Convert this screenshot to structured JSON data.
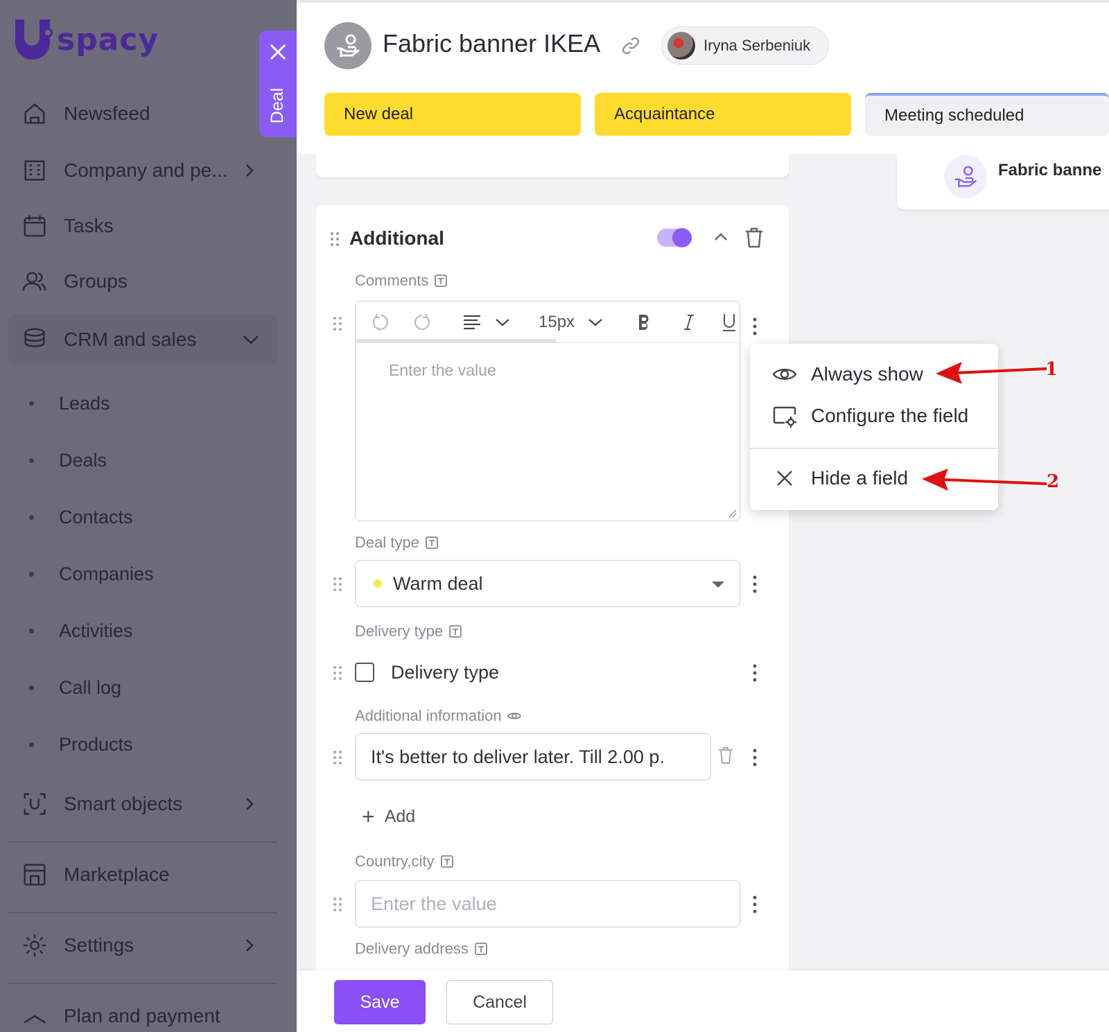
{
  "sidebar": {
    "logo_text": "spacy",
    "items": [
      {
        "label": "Newsfeed",
        "icon": "home-icon"
      },
      {
        "label": "Company and pe...",
        "icon": "company-icon"
      },
      {
        "label": "Tasks",
        "icon": "calendar-icon"
      },
      {
        "label": "Groups",
        "icon": "groups-icon"
      },
      {
        "label": "CRM and sales",
        "icon": "crm-icon"
      },
      {
        "label": "Smart objects",
        "icon": "smart-objects-icon"
      },
      {
        "label": "Marketplace",
        "icon": "marketplace-icon"
      },
      {
        "label": "Settings",
        "icon": "gear-icon"
      },
      {
        "label": "Plan and payment",
        "icon": "plan-icon"
      }
    ],
    "crm_subitems": [
      "Leads",
      "Deals",
      "Contacts",
      "Companies",
      "Activities",
      "Call log",
      "Products"
    ]
  },
  "deal_tab": {
    "label": "Deal"
  },
  "header": {
    "title": "Fabric banner IKEA",
    "user_name": "Iryna Serbeniuk",
    "stages": [
      {
        "label": "New deal",
        "state": "done"
      },
      {
        "label": "Acquaintance",
        "state": "done"
      },
      {
        "label": "Meeting scheduled",
        "state": "next"
      }
    ]
  },
  "right_card": {
    "title": "Fabric banne"
  },
  "section": {
    "title": "Additional",
    "enabled": true,
    "fields": {
      "comments": {
        "label": "Comments",
        "placeholder": "Enter the value"
      },
      "editor_font_size": "15px",
      "deal_type": {
        "label": "Deal type",
        "value": "Warm deal"
      },
      "delivery_type": {
        "label": "Delivery type",
        "checkbox_label": "Delivery type",
        "checked": false
      },
      "additional_info": {
        "label": "Additional information",
        "value": "It's better to deliver later. Till 2.00 p."
      },
      "add_label": "Add",
      "country_city": {
        "label": "Country,city",
        "placeholder": "Enter the value"
      },
      "delivery_address": {
        "label": "Delivery address"
      }
    }
  },
  "context_menu": {
    "items": [
      {
        "label": "Always show",
        "icon": "eye-icon"
      },
      {
        "label": "Configure the field",
        "icon": "configure-icon"
      },
      {
        "label": "Hide a field",
        "icon": "close-icon"
      }
    ]
  },
  "annotations": {
    "one": "1",
    "two": "2"
  },
  "footer": {
    "save_label": "Save",
    "cancel_label": "Cancel"
  },
  "colors": {
    "accent": "#8a4ff5",
    "stage_done": "#ffdc2e",
    "annotation": "#e01010",
    "sidebar_bg": "#6d6a79"
  }
}
